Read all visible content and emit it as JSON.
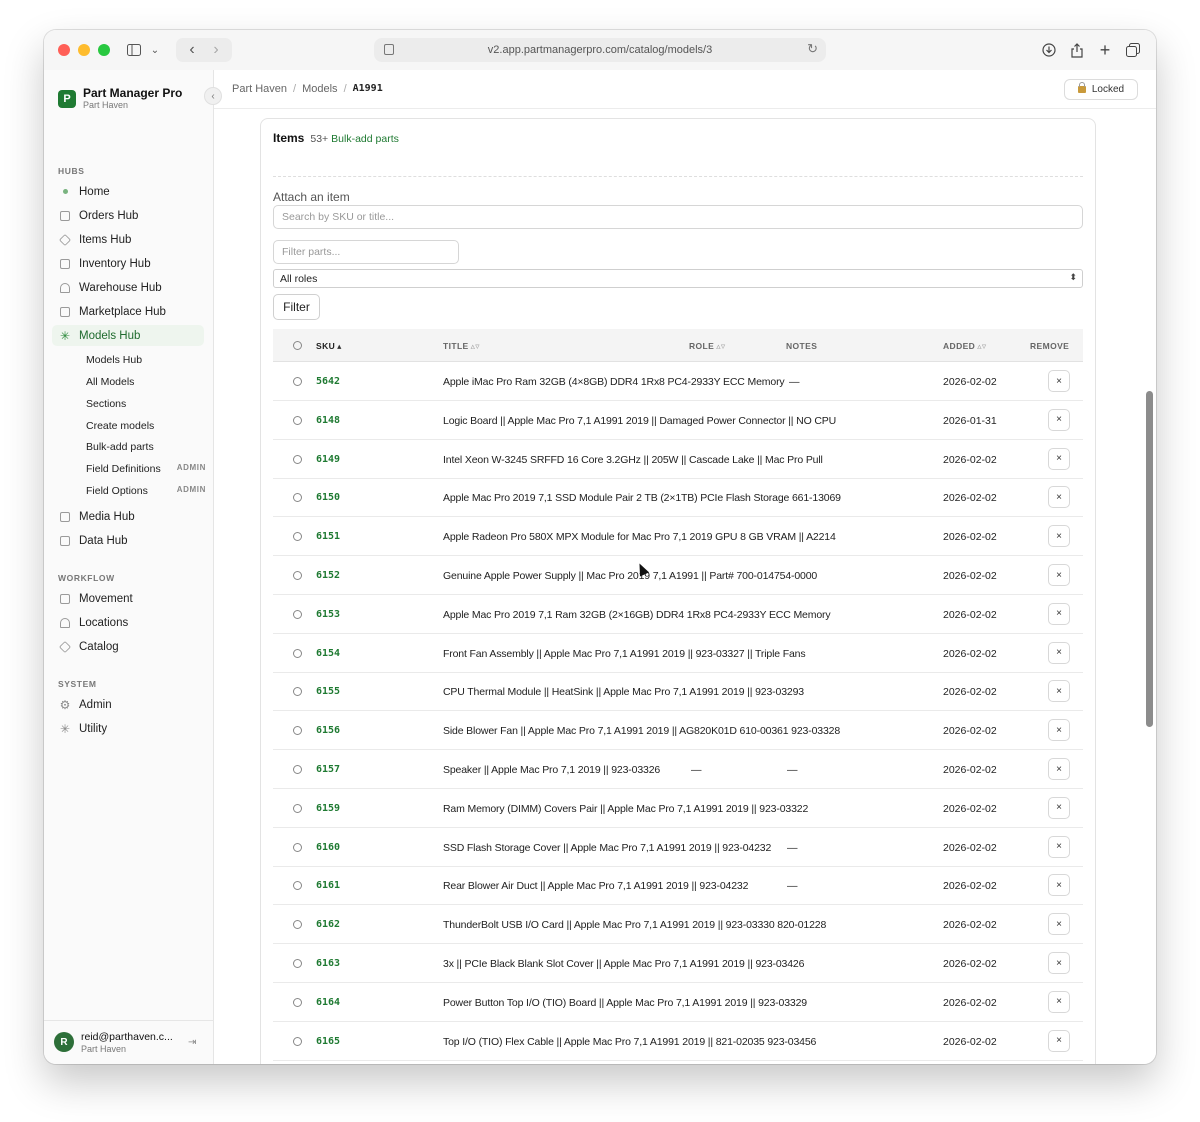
{
  "browser": {
    "url": "v2.app.partmanagerpro.com/catalog/models/3"
  },
  "app": {
    "name": "Part Manager Pro",
    "org": "Part Haven"
  },
  "sidebar": {
    "sections": {
      "hubs": "HUBS",
      "workflow": "WORKFLOW",
      "system": "SYSTEM"
    },
    "hubs": [
      {
        "label": "Home",
        "icon": "home-dot-icon"
      },
      {
        "label": "Orders Hub",
        "icon": "bag-icon"
      },
      {
        "label": "Items Hub",
        "icon": "cube-icon"
      },
      {
        "label": "Inventory Hub",
        "icon": "stack-icon"
      },
      {
        "label": "Warehouse Hub",
        "icon": "warehouse-icon"
      },
      {
        "label": "Marketplace Hub",
        "icon": "store-icon"
      },
      {
        "label": "Models Hub",
        "icon": "models-star-icon",
        "active": true
      }
    ],
    "models_sub": [
      {
        "label": "Models Hub",
        "tag": ""
      },
      {
        "label": "All Models",
        "tag": ""
      },
      {
        "label": "Sections",
        "tag": ""
      },
      {
        "label": "Create models",
        "tag": ""
      },
      {
        "label": "Bulk-add parts",
        "tag": ""
      },
      {
        "label": "Field Definitions",
        "tag": "ADMIN"
      },
      {
        "label": "Field Options",
        "tag": "ADMIN"
      }
    ],
    "hubs_more": [
      {
        "label": "Media Hub",
        "icon": "image-icon"
      },
      {
        "label": "Data Hub",
        "icon": "database-icon"
      }
    ],
    "workflow": [
      {
        "label": "Movement",
        "icon": "movement-icon"
      },
      {
        "label": "Locations",
        "icon": "location-icon"
      },
      {
        "label": "Catalog",
        "icon": "catalog-icon"
      }
    ],
    "system": [
      {
        "label": "Admin",
        "icon": "gear-icon"
      },
      {
        "label": "Utility",
        "icon": "utility-icon"
      }
    ],
    "user": {
      "initial": "R",
      "email": "reid@parthaven.c...",
      "org": "Part Haven"
    }
  },
  "header": {
    "breadcrumb": [
      "Part Haven",
      "Models",
      "A1991"
    ],
    "locked_label": "Locked"
  },
  "items": {
    "title": "Items",
    "count": "53+",
    "bulk_link": "Bulk-add parts",
    "attach_label": "Attach an item",
    "search_placeholder": "Search by SKU or title...",
    "filter_placeholder": "Filter parts...",
    "role_select": "All roles",
    "filter_button": "Filter",
    "columns": {
      "sku": "SKU",
      "title": "TITLE",
      "role": "ROLE",
      "notes": "NOTES",
      "added": "ADDED",
      "remove": "REMOVE"
    },
    "rows": [
      {
        "sku": "5642",
        "title": "Apple iMac Pro Ram 32GB (4×8GB) DDR4 1Rx8 PC4-2933Y ECC Memory",
        "notes": "—",
        "added": "2026-02-02"
      },
      {
        "sku": "6148",
        "title": "Logic Board || Apple Mac Pro 7,1 A1991 2019 || Damaged Power Connector || NO CPU",
        "notes": "",
        "added": "2026-01-31"
      },
      {
        "sku": "6149",
        "title": "Intel Xeon W-3245 SRFFD 16 Core 3.2GHz || 205W || Cascade Lake || Mac Pro Pull",
        "notes": "",
        "added": "2026-02-02"
      },
      {
        "sku": "6150",
        "title": "Apple Mac Pro 2019 7,1 SSD Module Pair 2 TB (2×1TB) PCIe Flash Storage 661-13069",
        "notes": "",
        "added": "2026-02-02"
      },
      {
        "sku": "6151",
        "title": "Apple Radeon Pro 580X MPX Module for Mac Pro 7,1 2019 GPU 8 GB VRAM || A2214",
        "notes": "",
        "added": "2026-02-02"
      },
      {
        "sku": "6152",
        "title": "Genuine Apple Power Supply || Mac Pro 2019 7,1 A1991 || Part# 700-014754-0000",
        "notes": "",
        "added": "2026-02-02"
      },
      {
        "sku": "6153",
        "title": "Apple Mac Pro 2019 7,1 Ram 32GB (2×16GB) DDR4 1Rx8 PC4-2933Y ECC Memory",
        "notes": "",
        "added": "2026-02-02"
      },
      {
        "sku": "6154",
        "title": "Front Fan Assembly || Apple Mac Pro 7,1 A1991 2019 || 923-03327 || Triple Fans",
        "notes": "",
        "added": "2026-02-02"
      },
      {
        "sku": "6155",
        "title": "CPU Thermal Module || HeatSink || Apple Mac Pro 7,1 A1991 2019 || 923-03293",
        "notes": "",
        "added": "2026-02-02"
      },
      {
        "sku": "6156",
        "title": "Side Blower Fan || Apple Mac Pro 7,1 A1991 2019 || AG820K01D 610-00361 923-03328",
        "notes": "",
        "added": "2026-02-02"
      },
      {
        "sku": "6157",
        "title": "Speaker || Apple Mac Pro 7,1 2019 || 923-03326",
        "role": "—",
        "notes": "—",
        "added": "2026-02-02"
      },
      {
        "sku": "6159",
        "title": "Ram Memory (DIMM) Covers Pair || Apple Mac Pro 7,1 A1991 2019 || 923-03322",
        "notes": "",
        "added": "2026-02-02"
      },
      {
        "sku": "6160",
        "title": "SSD Flash Storage Cover || Apple Mac Pro 7,1 A1991 2019 || 923-04232",
        "notes": "—",
        "added": "2026-02-02"
      },
      {
        "sku": "6161",
        "title": "Rear Blower Air Duct || Apple Mac Pro 7,1 A1991 2019 || 923-04232",
        "notes": "—",
        "added": "2026-02-02"
      },
      {
        "sku": "6162",
        "title": "ThunderBolt USB I/O Card || Apple Mac Pro 7,1 A1991 2019 || 923-03330 820-01228",
        "notes": "",
        "added": "2026-02-02"
      },
      {
        "sku": "6163",
        "title": "3x || PCIe Black Blank Slot Cover || Apple Mac Pro 7,1 A1991 2019 || 923-03426",
        "notes": "",
        "added": "2026-02-02"
      },
      {
        "sku": "6164",
        "title": "Power Button Top I/O (TIO) Board || Apple Mac Pro 7,1 A1991 2019 || 923-03329",
        "notes": "",
        "added": "2026-02-02"
      },
      {
        "sku": "6165",
        "title": "Top I/O (TIO) Flex Cable || Apple Mac Pro 7,1 A1991 2019 || 821-02035 923-03456",
        "notes": "",
        "added": "2026-02-02"
      }
    ],
    "remove_label": "×"
  },
  "colors": {
    "accent": "#1f7a32",
    "active_bg": "#eef5ee"
  }
}
